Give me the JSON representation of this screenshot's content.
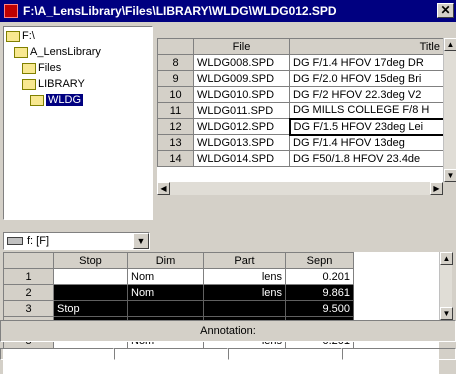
{
  "window": {
    "title": "F:\\A_LensLibrary\\Files\\LIBRARY\\WLDG\\WLDG012.SPD",
    "close_label": "✕"
  },
  "tree": {
    "items": [
      {
        "label": "F:\\",
        "level": 0,
        "icon": "open-folder-icon",
        "selected": false
      },
      {
        "label": "A_LensLibrary",
        "level": 1,
        "icon": "open-folder-icon",
        "selected": false
      },
      {
        "label": "Files",
        "level": 1,
        "icon": "open-folder-icon",
        "selected": false
      },
      {
        "label": "LIBRARY",
        "level": 1,
        "icon": "open-folder-icon",
        "selected": false
      },
      {
        "label": "WLDG",
        "level": 2,
        "icon": "open-folder-icon",
        "selected": true
      }
    ]
  },
  "drive": {
    "value": "f: [F]",
    "icon": "drive-icon"
  },
  "file_grid": {
    "headers": [
      "",
      "File",
      "Title"
    ],
    "rows": [
      {
        "num": "8",
        "file": "WLDG008.SPD",
        "title": "DG F/1.4 HFOV 17deg DR"
      },
      {
        "num": "9",
        "file": "WLDG009.SPD",
        "title": "DG F/2.0 HFOV 15deg Bri"
      },
      {
        "num": "10",
        "file": "WLDG010.SPD",
        "title": "DG F/2 HFOV 22.3deg V2"
      },
      {
        "num": "11",
        "file": "WLDG011.SPD",
        "title": "DG MILLS COLLEGE F/8 H"
      },
      {
        "num": "12",
        "file": "WLDG012.SPD",
        "title": "DG F/1.5 HFOV 23deg Lei"
      },
      {
        "num": "13",
        "file": "WLDG013.SPD",
        "title": "DG F/1.4 HFOV 13deg"
      },
      {
        "num": "14",
        "file": "WLDG014.SPD",
        "title": "DG F50/1.8  HFOV 23.4de"
      }
    ],
    "selected_num": "12"
  },
  "surface_grid": {
    "headers": [
      "",
      "Stop",
      "Dim",
      "Part",
      "Sepn"
    ],
    "rows": [
      {
        "num": "1",
        "stop": "",
        "dim": "Nom",
        "part": "lens",
        "sepn": "0.201",
        "dark": false
      },
      {
        "num": "2",
        "stop": "",
        "dim": "Nom",
        "part": "lens",
        "sepn": "9.861",
        "dark": true
      },
      {
        "num": "3",
        "stop": "Stop",
        "dim": "",
        "part": "",
        "sepn": "9.500",
        "dark": true
      },
      {
        "num": "4",
        "stop": "",
        "dim": "Nom",
        "part": "lens",
        "sepn": "0.201",
        "dark": true
      },
      {
        "num": "5",
        "stop": "",
        "dim": "Nom",
        "part": "lens",
        "sepn": "0.201",
        "dark": false
      }
    ]
  },
  "annotation": {
    "label": "Annotation:"
  }
}
